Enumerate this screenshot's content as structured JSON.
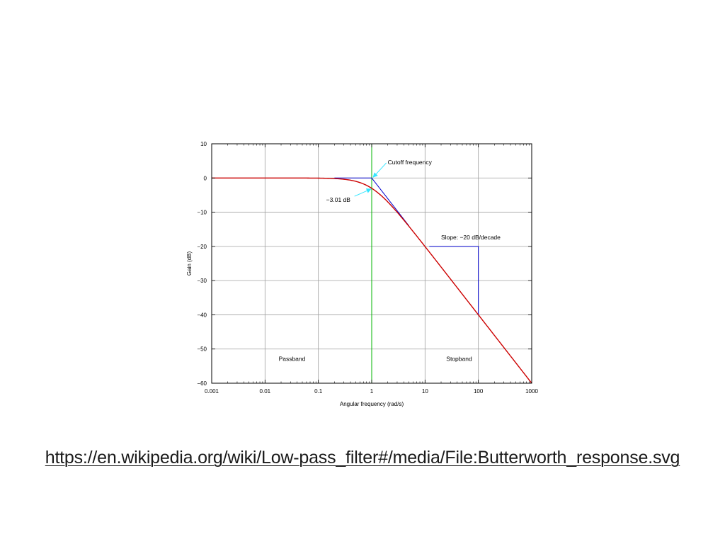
{
  "slide": {
    "link": "https://en.wikipedia.org/wiki/Low-pass_filter#/media/File:Butterworth_response.svg"
  },
  "chart_data": {
    "type": "line",
    "title": "",
    "xlabel": "Angular frequency (rad/s)",
    "ylabel": "Gain (dB)",
    "xscale": "log",
    "xlim": [
      0.001,
      1000
    ],
    "ylim": [
      -60,
      10
    ],
    "grid": true,
    "xticks": [
      0.001,
      0.01,
      0.1,
      1,
      10,
      100,
      1000
    ],
    "xtick_labels": [
      "0.001",
      "0.01",
      "0.1",
      "1",
      "10",
      "100",
      "1000"
    ],
    "yticks": [
      10,
      0,
      -10,
      -20,
      -30,
      -40,
      -50,
      -60
    ],
    "ytick_labels": [
      "10",
      "0",
      "−10",
      "−20",
      "−30",
      "−40",
      "−50",
      "−60"
    ],
    "series": [
      {
        "color": "#cc0000",
        "x": [
          0.001,
          0.01,
          0.1,
          0.2,
          0.3,
          0.5,
          0.7,
          1,
          1.5,
          2,
          3,
          5,
          7,
          10,
          20,
          50,
          100,
          300,
          1000
        ],
        "y": [
          0,
          0,
          -0.04,
          -0.17,
          -0.37,
          -0.97,
          -1.73,
          -3.01,
          -5.12,
          -6.99,
          -10,
          -14.15,
          -17.01,
          -20.04,
          -26.03,
          -33.98,
          -40,
          -49.54,
          -60
        ]
      },
      {
        "color": "#0000cc",
        "x": [
          0.2,
          1,
          5
        ],
        "y": [
          0,
          0,
          -14
        ]
      }
    ],
    "reference_lines": [
      {
        "orientation": "vertical",
        "x": 1,
        "color": "#00b400"
      }
    ],
    "slope_triangle": {
      "x": [
        12,
        100
      ],
      "y": [
        -20,
        -40
      ],
      "color": "#0000cc"
    },
    "annotations": [
      {
        "text": "Cutoff frequency",
        "x": 2,
        "y": 4,
        "arrow_to": [
          1,
          0
        ],
        "arrow_color": "#33e6ff"
      },
      {
        "text": "−3.01 dB",
        "x": 0.14,
        "y": -7,
        "arrow_to": [
          1,
          -3.01
        ],
        "arrow_color": "#33e6ff"
      },
      {
        "text": "Slope: −20 dB/decade",
        "x": 20,
        "y": -18,
        "arrow_to": null
      },
      {
        "text": "Passband",
        "x": 0.018,
        "y": -53.5,
        "arrow_to": null
      },
      {
        "text": "Stopband",
        "x": 25,
        "y": -53.5,
        "arrow_to": null
      }
    ]
  }
}
